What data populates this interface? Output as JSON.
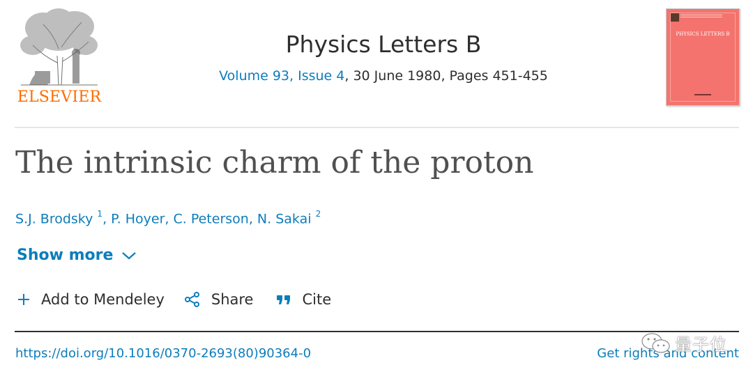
{
  "publisher": {
    "logo_text": "ELSEVIER",
    "logo_icon": "elsevier-tree-icon"
  },
  "journal": {
    "title": "Physics Letters B",
    "volume_issue": "Volume 93, Issue 4",
    "date_pages": ", 30 June 1980, Pages 451-455",
    "cover_title": "PHYSICS LETTERS B"
  },
  "article": {
    "title": "The intrinsic charm of the proton",
    "authors": [
      {
        "name": "S.J. Brodsky",
        "sup": "1"
      },
      {
        "name": "P. Hoyer",
        "sup": ""
      },
      {
        "name": "C. Peterson",
        "sup": ""
      },
      {
        "name": "N. Sakai",
        "sup": "2"
      }
    ]
  },
  "show_more": {
    "label": "Show more",
    "icon": "chevron-down-icon"
  },
  "actions": {
    "mendeley": "Add to Mendeley",
    "share": "Share",
    "cite": "Cite"
  },
  "footer": {
    "doi": "https://doi.org/10.1016/0370-2693(80)90364-0",
    "rights": "Get rights and content"
  },
  "watermark": {
    "text": "量子位"
  },
  "colors": {
    "link": "#0c7dbb",
    "brand_orange": "#ff6c00",
    "cover": "#f4736e",
    "text": "#2e2e2e"
  }
}
